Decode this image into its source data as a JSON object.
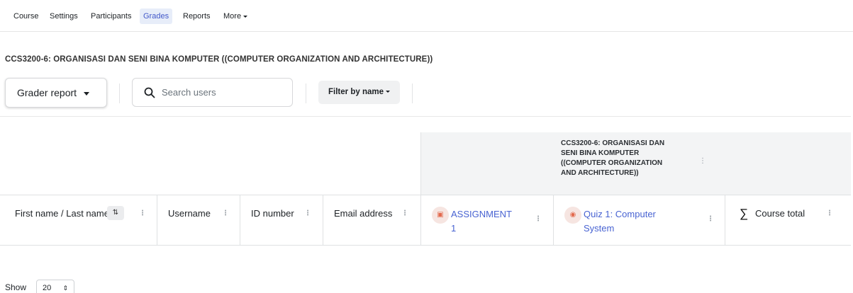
{
  "secondary_nav": {
    "items": [
      {
        "label": "Course"
      },
      {
        "label": "Settings"
      },
      {
        "label": "Participants"
      },
      {
        "label": "Grades",
        "active": true
      },
      {
        "label": "Reports"
      },
      {
        "label": "More"
      }
    ]
  },
  "course_title": "CCS3200-6: ORGANISASI DAN SENI BINA KOMPUTER ((COMPUTER ORGANIZATION AND ARCHITECTURE))",
  "tertiary_nav": {
    "report_selector": "Grader report",
    "search_placeholder": "Search users",
    "filter_label": "Filter by name"
  },
  "grader_table": {
    "category_header": "CCS3200-6: ORGANISASI DAN SENI BINA KOMPUTER ((COMPUTER ORGANIZATION AND ARCHITECTURE))",
    "columns": [
      {
        "label": "First name / Last name",
        "sortable": true
      },
      {
        "label": "Username"
      },
      {
        "label": "ID number"
      },
      {
        "label": "Email address"
      },
      {
        "label": "ASSIGNMENT 1",
        "icon": "assignment-icon"
      },
      {
        "label": "Quiz 1: Computer System",
        "icon": "quiz-icon"
      },
      {
        "label": "Course total",
        "icon": "sigma-icon"
      }
    ]
  },
  "pagination": {
    "show_label": "Show",
    "per_page": "20"
  },
  "colors": {
    "link": "#4863d2",
    "active_nav_bg": "#e7edf9",
    "activity_icon": "#e2694d",
    "header_bg": "#f3f4f5"
  }
}
